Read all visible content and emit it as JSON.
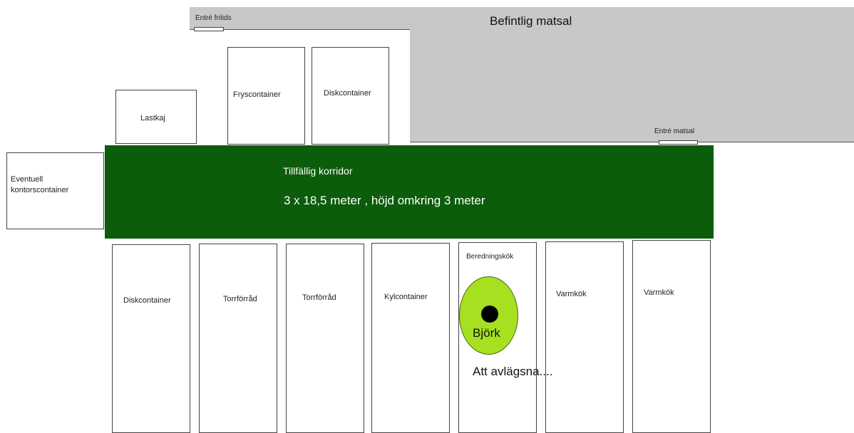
{
  "existing_dining": {
    "label": "Befintlig matsal"
  },
  "entrances": {
    "leisure": "Entré fritids",
    "dining": "Entré matsal"
  },
  "top_row": {
    "loading_dock": "Lastkaj",
    "freezer": "Fryscontainer",
    "dishwash": "Diskcontainer"
  },
  "office": {
    "line1": "Eventuell",
    "line2": "kontorscontainer"
  },
  "corridor": {
    "title": "Tillfällig korridor",
    "dimensions": "3 x 18,5 meter , höjd omkring 3 meter",
    "color": "#0b5c0b"
  },
  "bottom_row": {
    "dishwash": "Diskcontainer",
    "dry_storage_1": "Torrförråd",
    "dry_storage_2": "Torrförråd",
    "cooler": "Kylcontainer",
    "prep_kitchen": "Beredningskök",
    "hot_kitchen_1": "Varmkök",
    "hot_kitchen_2": "Varmkök"
  },
  "tree": {
    "label": "Björk",
    "note": "Att avlägsna....",
    "color": "#a6e021"
  }
}
